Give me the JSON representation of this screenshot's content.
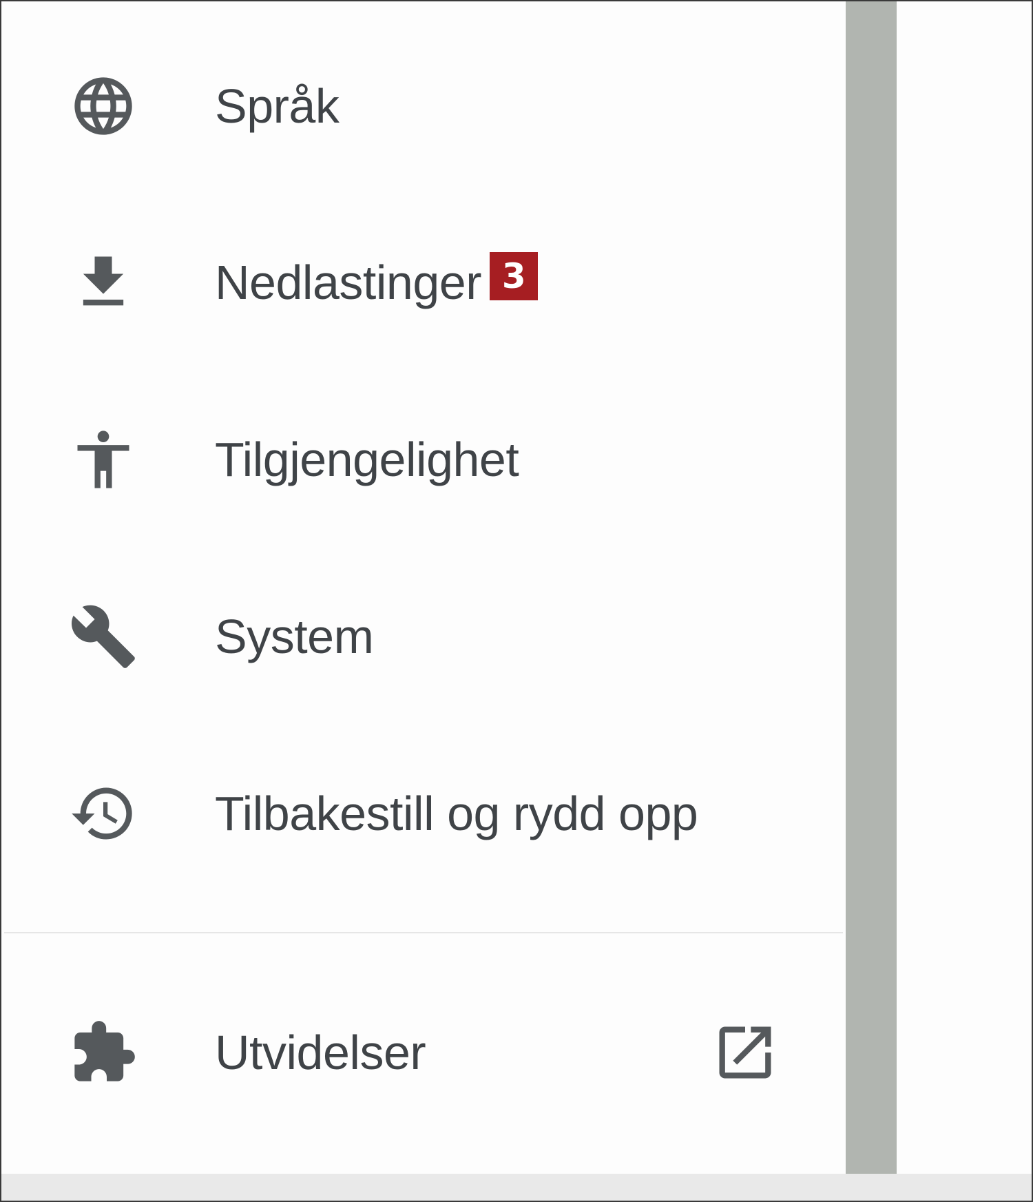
{
  "menu": {
    "items": [
      {
        "label": "Språk",
        "icon": "globe-icon"
      },
      {
        "label": "Nedlastinger",
        "icon": "download-icon",
        "badge": "3",
        "badge_color": "#a61e22"
      },
      {
        "label": "Tilgjengelighet",
        "icon": "accessibility-icon"
      },
      {
        "label": "System",
        "icon": "wrench-icon"
      },
      {
        "label": "Tilbakestill og rydd opp",
        "icon": "history-icon"
      }
    ],
    "extensions": {
      "label": "Utvidelser",
      "icon": "puzzle-icon",
      "trailing_icon": "open-in-new-icon"
    }
  },
  "colors": {
    "text": "#3f4347",
    "icon": "#55595c",
    "scrollbar": "#b1b5b0",
    "divider": "#e6e6e6"
  }
}
